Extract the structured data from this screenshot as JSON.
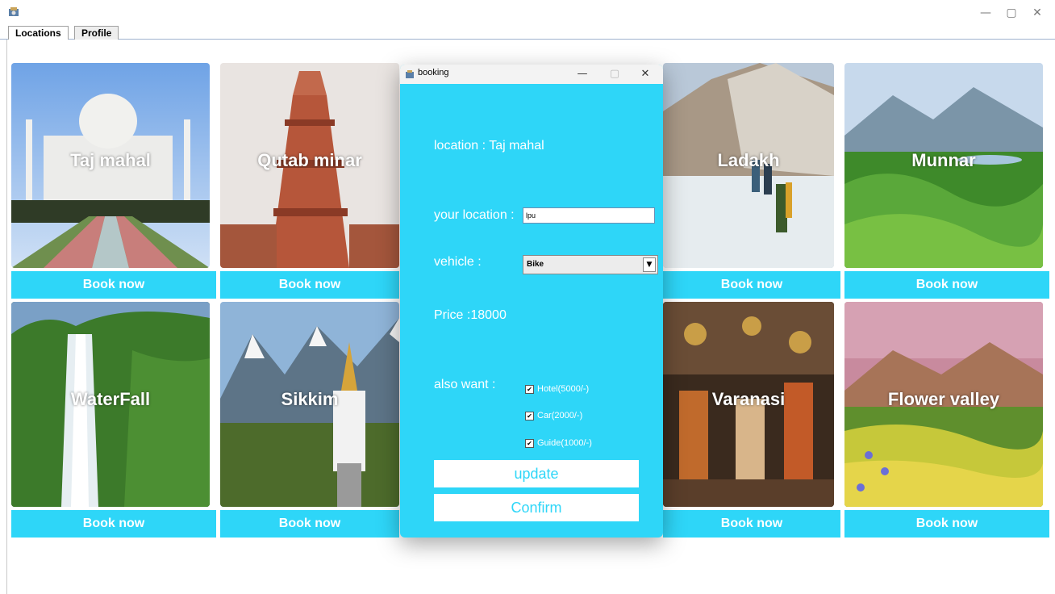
{
  "window": {
    "minimize": "—",
    "maximize": "▢",
    "close": "✕"
  },
  "tabs": [
    {
      "label": "Locations",
      "active": true
    },
    {
      "label": "Profile",
      "active": false
    }
  ],
  "cards": [
    {
      "label": "Taj mahal",
      "button": "Book now"
    },
    {
      "label": "Qutab minar",
      "button": "Book now"
    },
    {
      "label": "",
      "button": ""
    },
    {
      "label": "Ladakh",
      "button": "Book now"
    },
    {
      "label": "Munnar",
      "button": "Book now"
    },
    {
      "label": "WaterFall",
      "button": "Book now"
    },
    {
      "label": "Sikkim",
      "button": "Book now"
    },
    {
      "label": "",
      "button": ""
    },
    {
      "label": "Varanasi",
      "button": "Book now"
    },
    {
      "label": "Flower valley",
      "button": "Book now"
    }
  ],
  "dialog": {
    "title": "booking",
    "minimize": "—",
    "maximize": "▢",
    "close": "✕",
    "location_label": "location : Taj mahal",
    "your_location_label": "your location :",
    "your_location_value": "lpu",
    "vehicle_label": "vehicle :",
    "vehicle_selected": "Bike",
    "price_label": "Price :18000",
    "also_want_label": "also want :",
    "options": [
      {
        "label": "Hotel(5000/-)",
        "checked": true
      },
      {
        "label": "Car(2000/-)",
        "checked": true
      },
      {
        "label": "Guide(1000/-)",
        "checked": true
      }
    ],
    "update_button": "update",
    "confirm_button": "Confirm"
  },
  "colors": {
    "accent": "#2ed6f8",
    "tab_border": "#9fb3cf"
  }
}
